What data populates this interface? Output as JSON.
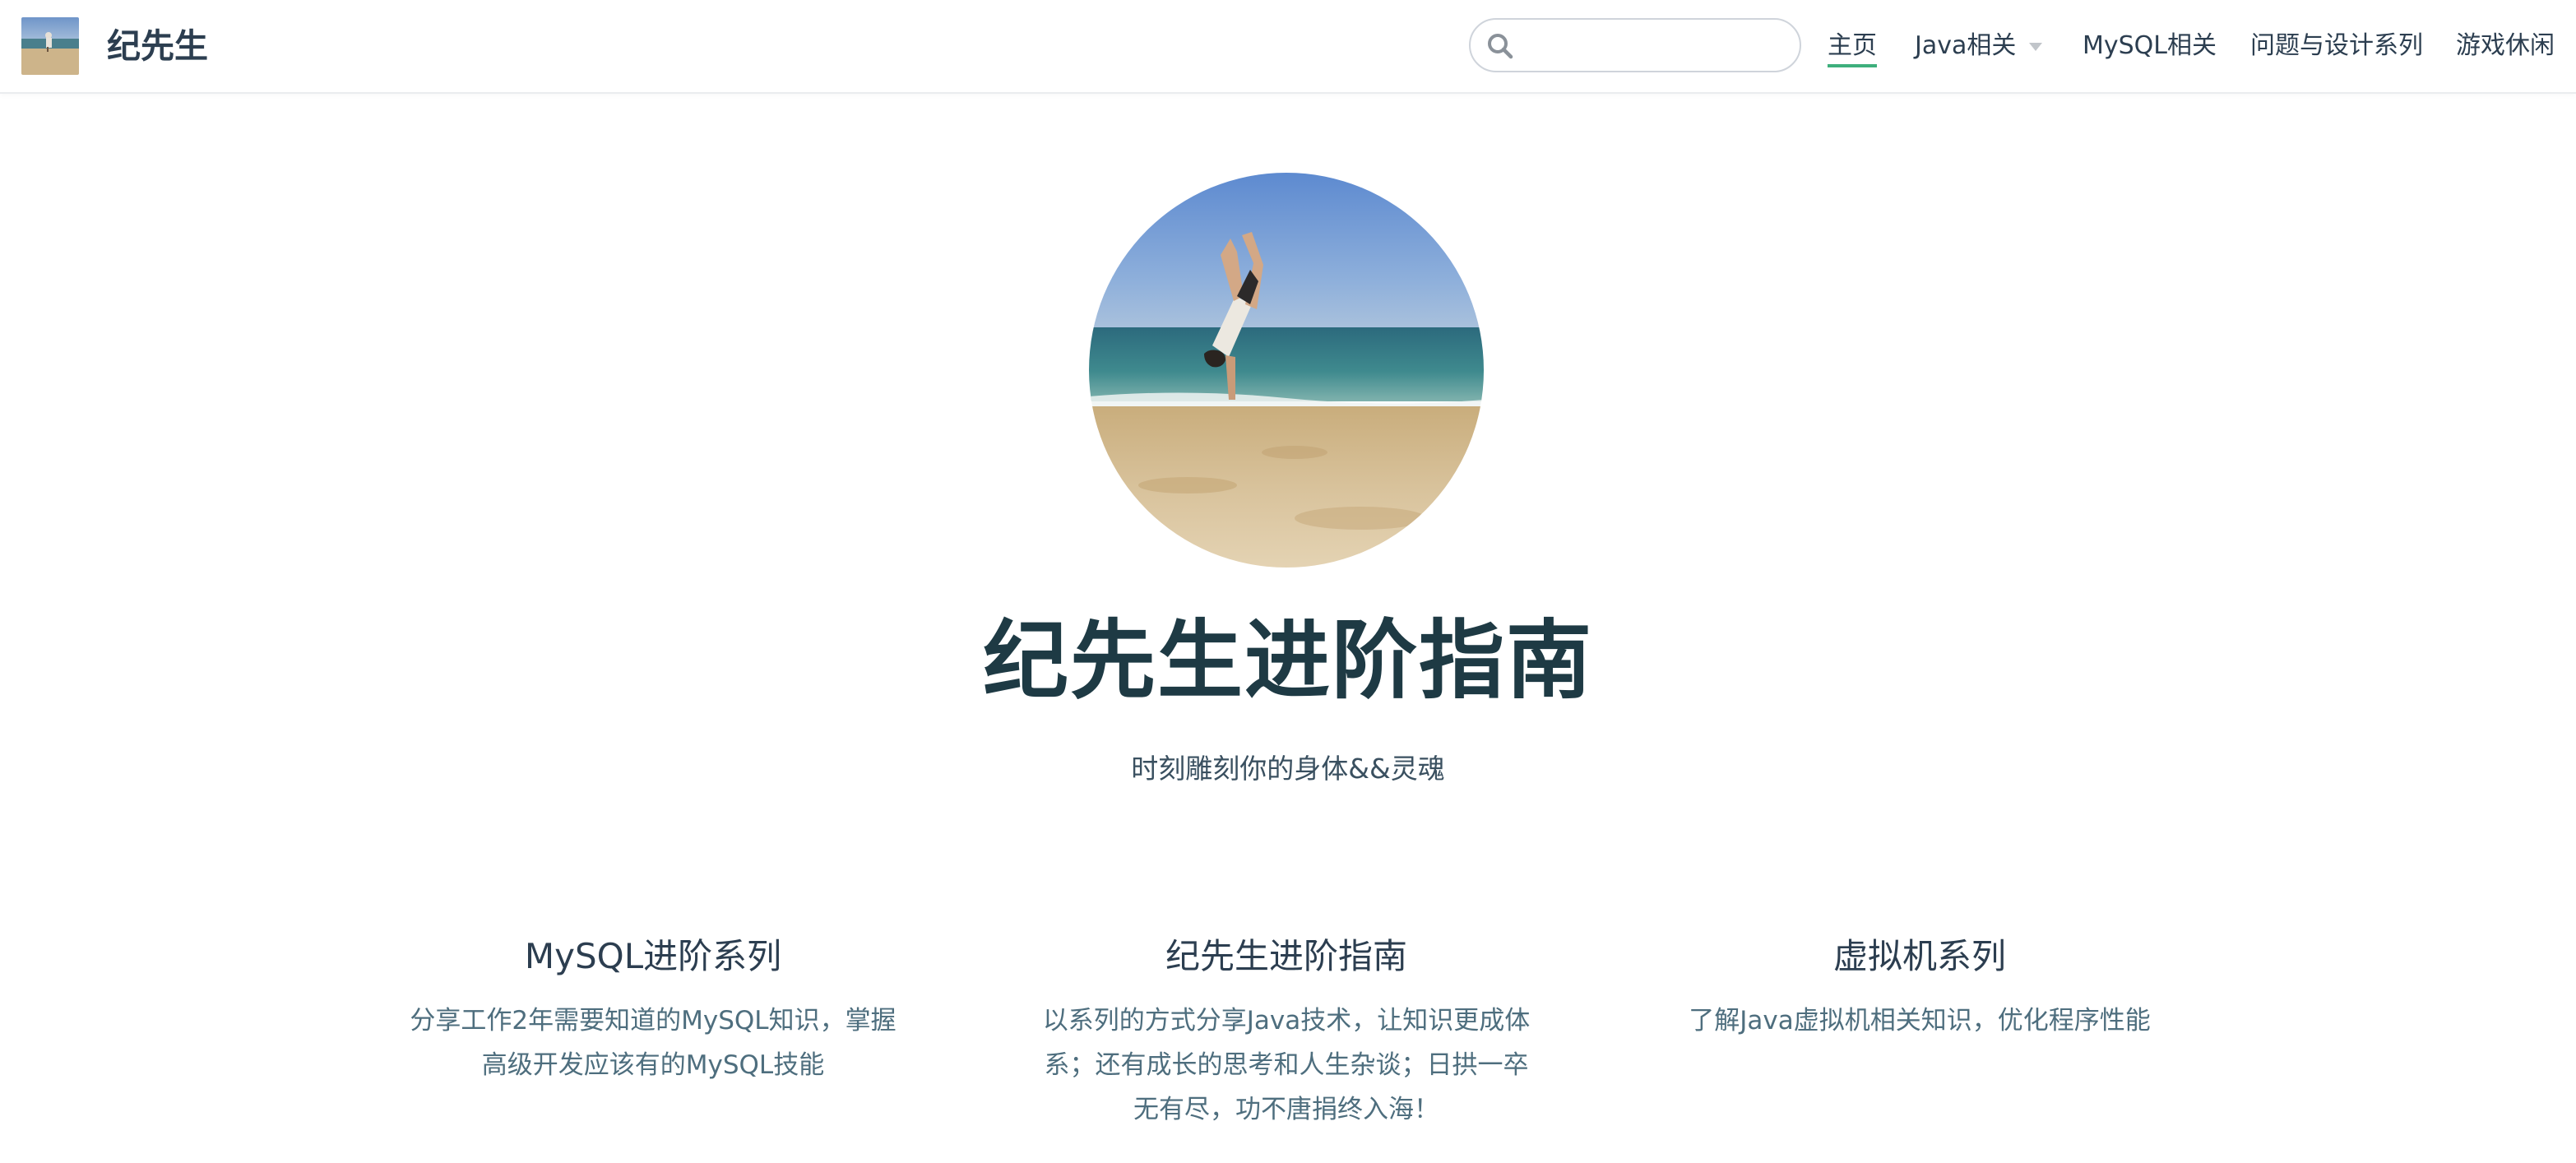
{
  "header": {
    "site_name": "纪先生",
    "search": {
      "value": "",
      "placeholder": ""
    },
    "nav": [
      {
        "label": "主页",
        "active": true
      },
      {
        "label": "Java相关",
        "has_dropdown": true
      },
      {
        "label": "MySQL相关"
      },
      {
        "label": "问题与设计系列"
      },
      {
        "label": "游戏休闲"
      }
    ]
  },
  "hero": {
    "title": "纪先生进阶指南",
    "description": "时刻雕刻你的身体&&灵魂"
  },
  "features": [
    {
      "title": "MySQL进阶系列",
      "details": "分享工作2年需要知道的MySQL知识，掌握高级开发应该有的MySQL技能"
    },
    {
      "title": "纪先生进阶指南",
      "details": "以系列的方式分享Java技术，让知识更成体系；还有成长的思考和人生杂谈；日拱一卒无有尽，功不唐捐终入海！"
    },
    {
      "title": "虚拟机系列",
      "details": "了解Java虚拟机相关知识，优化程序性能"
    }
  ],
  "colors": {
    "accent": "#3eaf7c",
    "text": "#2c3e50",
    "title": "#1e3a44",
    "border": "#eaecef"
  },
  "icons": [
    "search-icon",
    "arrow-down-icon"
  ]
}
